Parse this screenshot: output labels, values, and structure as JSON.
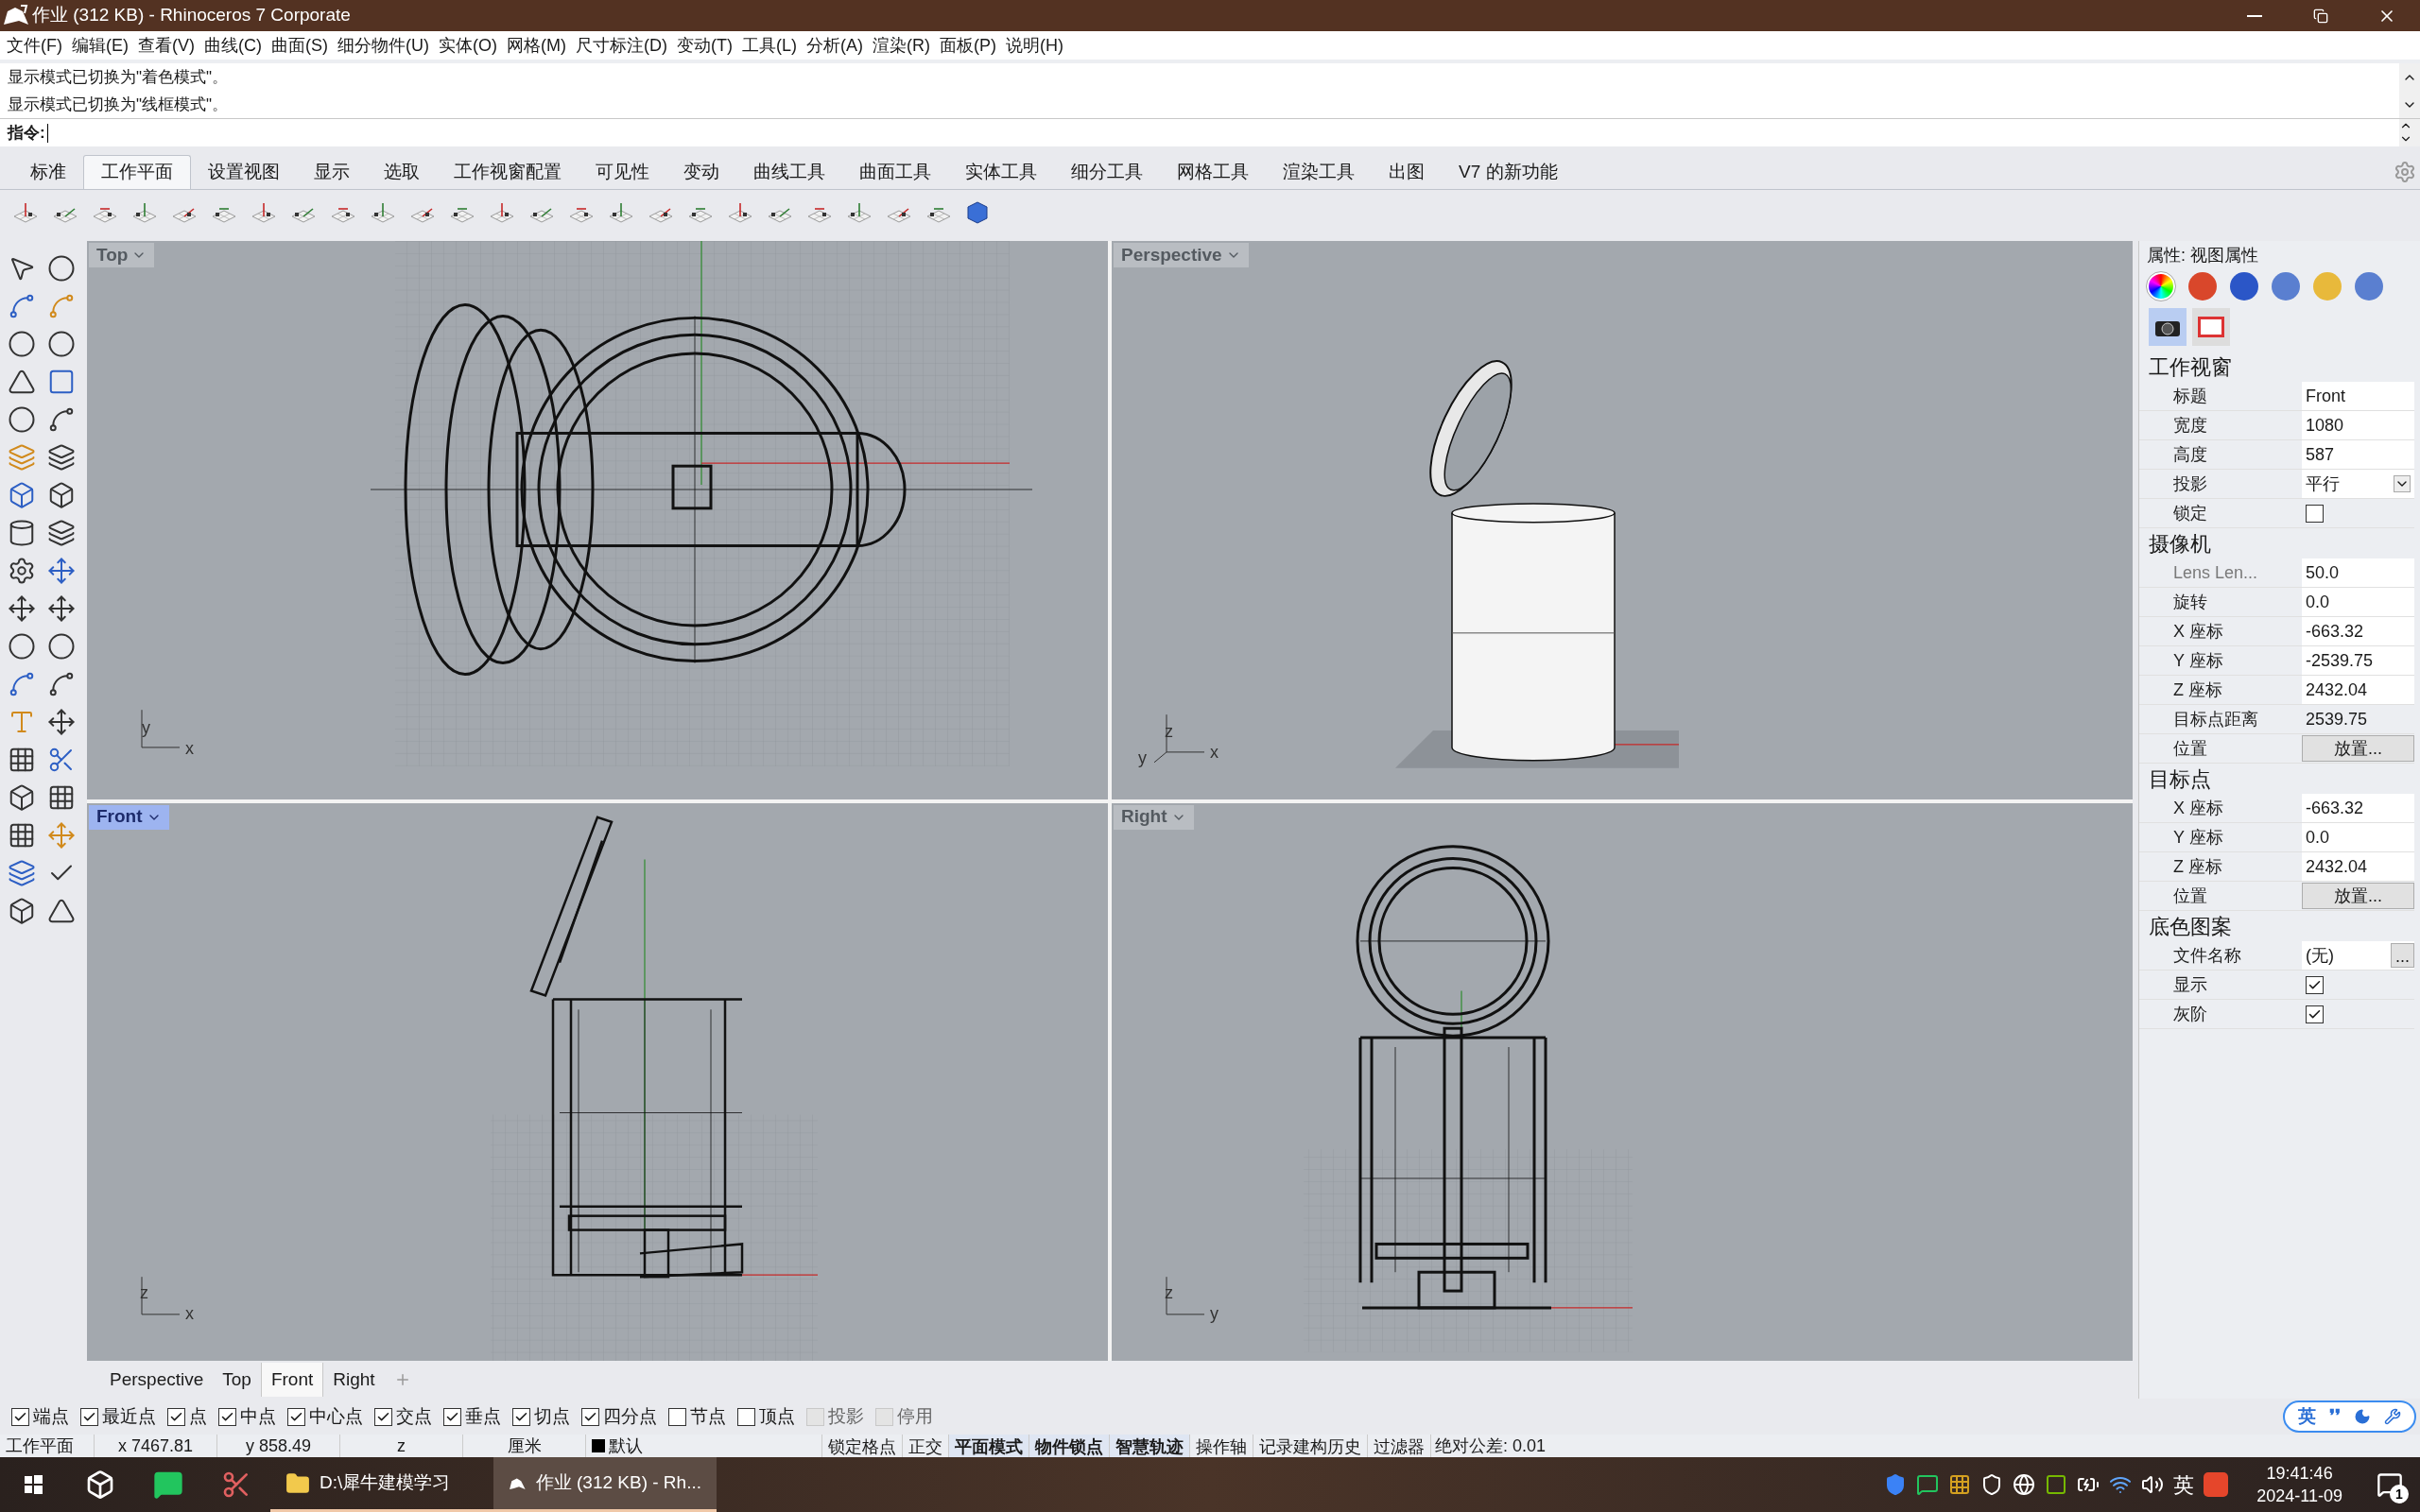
{
  "window": {
    "title": "作业 (312 KB) - Rhinoceros 7 Corporate"
  },
  "menu": [
    "文件(F)",
    "编辑(E)",
    "查看(V)",
    "曲线(C)",
    "曲面(S)",
    "细分物件(U)",
    "实体(O)",
    "网格(M)",
    "尺寸标注(D)",
    "变动(T)",
    "工具(L)",
    "分析(A)",
    "渲染(R)",
    "面板(P)",
    "说明(H)"
  ],
  "command_history": [
    "显示模式已切换为\"着色模式\"。",
    "显示模式已切换为\"线框模式\"。"
  ],
  "command_prompt": "指令:",
  "toolbar_tabs": [
    {
      "label": "标准",
      "selected": false
    },
    {
      "label": "工作平面",
      "selected": true
    },
    {
      "label": "设置视图",
      "selected": false
    },
    {
      "label": "显示",
      "selected": false
    },
    {
      "label": "选取",
      "selected": false
    },
    {
      "label": "工作视窗配置",
      "selected": false
    },
    {
      "label": "可见性",
      "selected": false
    },
    {
      "label": "变动",
      "selected": false
    },
    {
      "label": "曲线工具",
      "selected": false
    },
    {
      "label": "曲面工具",
      "selected": false
    },
    {
      "label": "实体工具",
      "selected": false
    },
    {
      "label": "细分工具",
      "selected": false
    },
    {
      "label": "网格工具",
      "selected": false
    },
    {
      "label": "渲染工具",
      "selected": false
    },
    {
      "label": "出图",
      "selected": false
    },
    {
      "label": "V7 的新功能",
      "selected": false
    }
  ],
  "viewports": [
    {
      "kind": "top",
      "title": "Top",
      "selected": false,
      "axes": [
        "y",
        "x"
      ]
    },
    {
      "kind": "perspective",
      "title": "Perspective",
      "selected": false,
      "axes": [
        "z",
        "y",
        "x"
      ]
    },
    {
      "kind": "front",
      "title": "Front",
      "selected": true,
      "axes": [
        "z",
        "x"
      ]
    },
    {
      "kind": "right",
      "title": "Right",
      "selected": false,
      "axes": [
        "z",
        "y"
      ]
    }
  ],
  "viewport_tabs": [
    {
      "label": "Perspective",
      "selected": false
    },
    {
      "label": "Top",
      "selected": false
    },
    {
      "label": "Front",
      "selected": true
    },
    {
      "label": "Right",
      "selected": false
    }
  ],
  "properties": {
    "title": "属性: 视图属性",
    "panel_tabs": [
      {
        "selected": true
      },
      {
        "selected": false
      },
      {
        "selected": false
      },
      {
        "selected": false
      },
      {
        "selected": false
      },
      {
        "selected": false
      }
    ],
    "view_buttons": [
      {
        "selected": true
      },
      {
        "selected": false
      }
    ],
    "sections": [
      {
        "title": "工作视窗",
        "rows": [
          {
            "kind": "text",
            "label": "标题",
            "value": "Front",
            "disabled": false
          },
          {
            "kind": "text",
            "label": "宽度",
            "value": "1080",
            "disabled": false
          },
          {
            "kind": "text",
            "label": "高度",
            "value": "587",
            "disabled": false
          },
          {
            "kind": "dropdown",
            "label": "投影",
            "value": "平行",
            "disabled": false
          },
          {
            "kind": "checkbox",
            "label": "锁定",
            "checked": false,
            "disabled": false
          }
        ]
      },
      {
        "title": "摄像机",
        "rows": [
          {
            "kind": "text",
            "label": "Lens Len...",
            "value": "50.0",
            "disabled": true
          },
          {
            "kind": "text",
            "label": "旋转",
            "value": "0.0",
            "disabled": false
          },
          {
            "kind": "text",
            "label": "X 座标",
            "value": "-663.32",
            "disabled": false
          },
          {
            "kind": "text",
            "label": "Y 座标",
            "value": "-2539.75",
            "disabled": false
          },
          {
            "kind": "text",
            "label": "Z 座标",
            "value": "2432.04",
            "disabled": false
          },
          {
            "kind": "readonly",
            "label": "目标点距离",
            "value": "2539.75",
            "disabled": false
          },
          {
            "kind": "button",
            "label": "位置",
            "value": "放置...",
            "disabled": false
          }
        ]
      },
      {
        "title": "目标点",
        "rows": [
          {
            "kind": "text",
            "label": "X 座标",
            "value": "-663.32",
            "disabled": false
          },
          {
            "kind": "text",
            "label": "Y 座标",
            "value": "0.0",
            "disabled": false
          },
          {
            "kind": "text",
            "label": "Z 座标",
            "value": "2432.04",
            "disabled": false
          },
          {
            "kind": "button",
            "label": "位置",
            "value": "放置...",
            "disabled": false
          }
        ]
      },
      {
        "title": "底色图案",
        "rows": [
          {
            "kind": "file",
            "label": "文件名称",
            "value": "(无)",
            "button": "...",
            "disabled": false
          },
          {
            "kind": "checkbox",
            "label": "显示",
            "checked": true,
            "disabled": false
          },
          {
            "kind": "checkbox",
            "label": "灰阶",
            "checked": true,
            "disabled": false
          }
        ]
      }
    ]
  },
  "osnaps": [
    {
      "label": "端点",
      "checked": true,
      "disabled": false
    },
    {
      "label": "最近点",
      "checked": true,
      "disabled": false
    },
    {
      "label": "点",
      "checked": true,
      "disabled": false
    },
    {
      "label": "中点",
      "checked": true,
      "disabled": false
    },
    {
      "label": "中心点",
      "checked": true,
      "disabled": false
    },
    {
      "label": "交点",
      "checked": true,
      "disabled": false
    },
    {
      "label": "垂点",
      "checked": true,
      "disabled": false
    },
    {
      "label": "切点",
      "checked": true,
      "disabled": false
    },
    {
      "label": "四分点",
      "checked": true,
      "disabled": false
    },
    {
      "label": "节点",
      "checked": false,
      "disabled": false
    },
    {
      "label": "顶点",
      "checked": false,
      "disabled": false
    },
    {
      "label": "投影",
      "checked": false,
      "disabled": true
    },
    {
      "label": "停用",
      "checked": false,
      "disabled": true
    }
  ],
  "status_bar": {
    "cplane": "工作平面",
    "x": "x 7467.81",
    "y": "y 858.49",
    "z": "z",
    "units": "厘米",
    "layer": {
      "label": "默认",
      "color": "#000000"
    },
    "toggles": [
      {
        "label": "锁定格点",
        "on": false
      },
      {
        "label": "正交",
        "on": false
      },
      {
        "label": "平面模式",
        "on": true
      },
      {
        "label": "物件锁点",
        "on": true
      },
      {
        "label": "智慧轨迹",
        "on": true
      },
      {
        "label": "操作轴",
        "on": false
      },
      {
        "label": "记录建构历史",
        "on": false
      },
      {
        "label": "过滤器",
        "on": false
      }
    ],
    "tolerance": "绝对公差: 0.01"
  },
  "ime": {
    "mode": "英",
    "punct": "❜❜"
  },
  "taskbar": {
    "tasks": [
      {
        "label": "D:\\犀牛建模学习",
        "selected": false
      },
      {
        "label": "作业 (312 KB) - Rh...",
        "selected": true
      }
    ],
    "lang": "英",
    "time": "19:41:46",
    "date": "2024-11-09",
    "notifications": "1"
  }
}
